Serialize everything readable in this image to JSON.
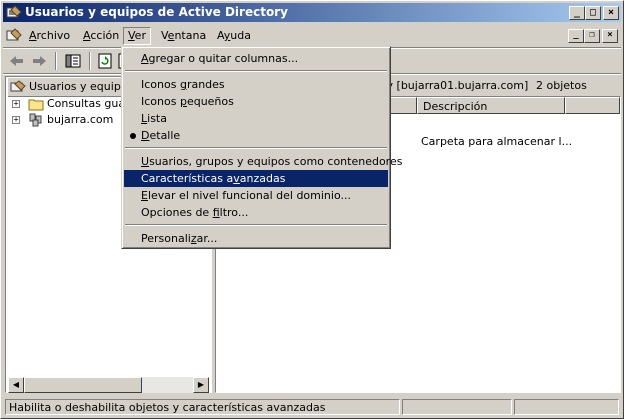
{
  "window": {
    "title": "Usuarios y equipos de Active Directory",
    "controls": {
      "minimize": "_",
      "maximize": "□",
      "close": "×"
    }
  },
  "menubar": {
    "items": [
      {
        "label": "Archivo",
        "mnemonic_index": 0
      },
      {
        "label": "Acción",
        "mnemonic_index": 0
      },
      {
        "label": "Ver",
        "mnemonic_index": 0
      },
      {
        "label": "Ventana",
        "mnemonic_index": 1
      },
      {
        "label": "Ayuda",
        "mnemonic_index": 1
      }
    ],
    "mdi_controls": {
      "minimize": "_",
      "restore": "❐",
      "close": "×"
    }
  },
  "toolbar": {
    "icons": [
      "back-arrow-icon",
      "forward-arrow-icon",
      "show-hide-tree-icon",
      "refresh-icon",
      "export-list-icon"
    ]
  },
  "tree": {
    "root_label": "Usuarios y equipos d",
    "items": [
      {
        "label": "Consultas guard",
        "expander": "+",
        "icon": "folder-icon"
      },
      {
        "label": "bujarra.com",
        "expander": "+",
        "icon": "domain-icon"
      }
    ]
  },
  "details": {
    "address_text": "ry [bujarra01.bujarra.com]",
    "object_count": "2 objetos",
    "columns": [
      "Descripción"
    ],
    "rows": [
      {
        "description": "Carpeta para almacenar l..."
      }
    ]
  },
  "ver_menu": {
    "groups": [
      [
        {
          "label": "Agregar o quitar columnas...",
          "mnemonic": "A"
        }
      ],
      [
        {
          "label": "Iconos grandes",
          "mnemonic": "g"
        },
        {
          "label": "Iconos pequeños",
          "mnemonic": "p"
        },
        {
          "label": "Lista",
          "mnemonic": "L"
        },
        {
          "label": "Detalle",
          "mnemonic": "D",
          "checked": true
        }
      ],
      [
        {
          "label": "Usuarios, grupos y equipos como contenedores",
          "mnemonic": "U"
        },
        {
          "label": "Características avanzadas",
          "mnemonic": "v",
          "highlighted": true
        },
        {
          "label": "Elevar el nivel funcional del dominio...",
          "mnemonic": "E"
        },
        {
          "label": "Opciones de filtro...",
          "mnemonic": "f"
        }
      ],
      [
        {
          "label": "Personalizar...",
          "mnemonic": "z"
        }
      ]
    ]
  },
  "statusbar": {
    "text": "Habilita o deshabilita objetos y características avanzadas"
  },
  "colors": {
    "titlebar_start": "#0a246a",
    "titlebar_end": "#a6caf0",
    "highlight": "#0a246a",
    "face": "#d4d0c8"
  }
}
